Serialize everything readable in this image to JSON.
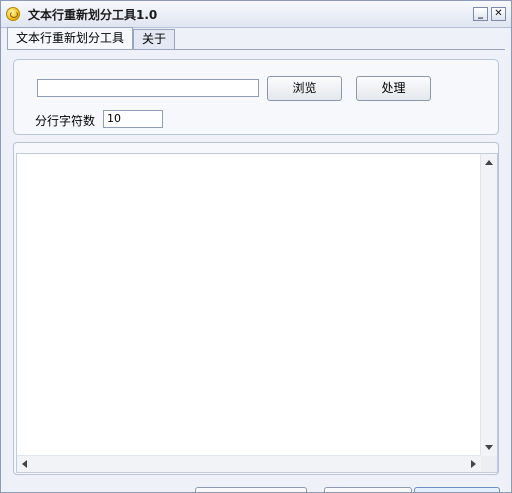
{
  "window": {
    "title": "文本行重新划分工具1.0",
    "minimize_glyph": "_",
    "close_glyph": "✕"
  },
  "tabs": [
    {
      "label": "文本行重新划分工具",
      "active": true
    },
    {
      "label": "关于",
      "active": false
    }
  ],
  "form": {
    "file_path_value": "",
    "browse_label": "浏览",
    "process_label": "处理",
    "chars_per_line_label": "分行字符数",
    "chars_per_line_value": "10"
  },
  "output": {
    "text": ""
  },
  "colors": {
    "window_bg": "#eef1f7",
    "titlebar_top": "#f7f9fd",
    "accent_blue_button": "#c7ddf6"
  },
  "icons": [
    "app-icon",
    "minimize-icon",
    "close-icon",
    "scroll-up-icon",
    "scroll-down-icon",
    "scroll-left-icon",
    "scroll-right-icon"
  ]
}
